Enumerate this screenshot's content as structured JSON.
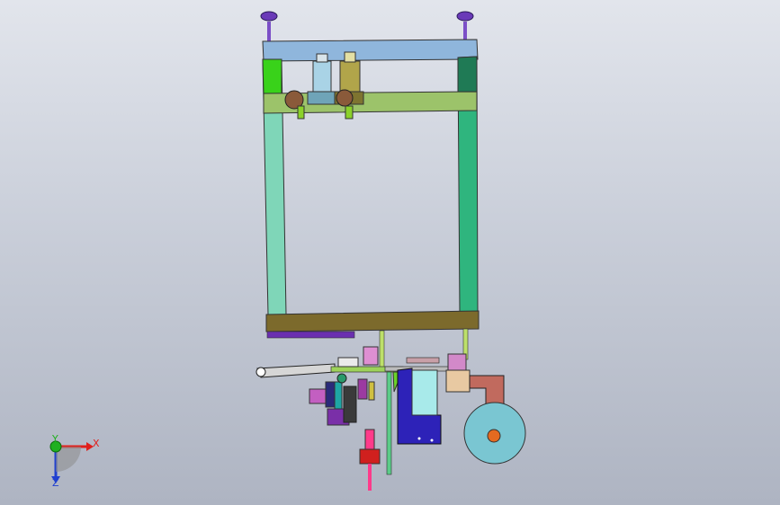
{
  "viewport": {
    "background_top": "#e2e5ec",
    "background_bottom": "#aeb4c2"
  },
  "triad": {
    "x_label": "X",
    "y_label": "Y",
    "z_label": "Z",
    "x_color": "#e0201c",
    "y_color": "#20b020",
    "z_color": "#2040d0"
  },
  "model": {
    "icon": "cad-assembly-icon",
    "colors": {
      "top_beam": "#8fb6dc",
      "upper_rail": "#9cc36a",
      "left_post": "#7fd6b8",
      "right_post": "#2fb57e",
      "bottom_beam": "#7c6a2c",
      "accent_purple": "#6a2fb0",
      "blue_plate": "#2d22b8",
      "wheel": "#7ac6d2",
      "arm": "#c16a5e",
      "red_part": "#d0201e"
    }
  }
}
